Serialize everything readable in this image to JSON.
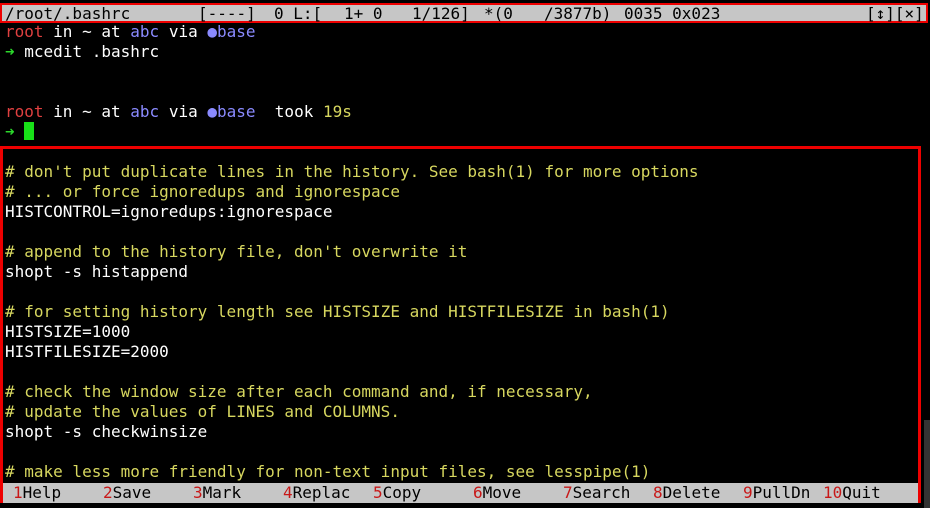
{
  "colors": {
    "comment": "#d7d75f",
    "prompt_user": "#e04040",
    "prompt_accent": "#8a8aff",
    "prompt_arrow": "#2bd92b",
    "highlight_frame": "#ee0000",
    "statusbar_bg": "#c6c6c6"
  },
  "titlebar": {
    "path": "/root/.bashrc",
    "flags": "[----]",
    "col": "0 L:[",
    "line_pos": "1+ 0",
    "line_total": "1/126]",
    "char_pos": "*(0",
    "char_total": "/3877b)",
    "char_code": "0035 0x023",
    "buttons": "[↕][×]"
  },
  "terminal": {
    "line1": {
      "user": "root",
      "in": "in",
      "dir": "~",
      "at": "at",
      "host": "abc",
      "via": "via",
      "env_icon": "●",
      "env": "base"
    },
    "line2": {
      "arrow": "➜",
      "command": "mcedit .bashrc"
    },
    "line3": {
      "user": "root",
      "in": "in",
      "dir": "~",
      "at": "at",
      "host": "abc",
      "via": "via",
      "env_icon": "●",
      "env": "base",
      "took": "took",
      "duration": "19s"
    },
    "line4": {
      "arrow": "➜"
    }
  },
  "editor": {
    "lines": [
      {
        "type": "comment",
        "text": "# don't put duplicate lines in the history. See bash(1) for more options"
      },
      {
        "type": "comment",
        "text": "# ... or force ignoredups and ignorespace"
      },
      {
        "type": "code",
        "text": "HISTCONTROL=ignoredups:ignorespace"
      },
      {
        "type": "blank",
        "text": ""
      },
      {
        "type": "comment",
        "text": "# append to the history file, don't overwrite it"
      },
      {
        "type": "code",
        "text": "shopt -s histappend"
      },
      {
        "type": "blank",
        "text": ""
      },
      {
        "type": "comment",
        "text": "# for setting history length see HISTSIZE and HISTFILESIZE in bash(1)"
      },
      {
        "type": "code",
        "text": "HISTSIZE=1000"
      },
      {
        "type": "code",
        "text": "HISTFILESIZE=2000"
      },
      {
        "type": "blank",
        "text": ""
      },
      {
        "type": "comment",
        "text": "# check the window size after each command and, if necessary,"
      },
      {
        "type": "comment",
        "text": "# update the values of LINES and COLUMNS."
      },
      {
        "type": "code",
        "text": "shopt -s checkwinsize"
      },
      {
        "type": "blank",
        "text": ""
      },
      {
        "type": "comment",
        "text": "# make less more friendly for non-text input files, see lesspipe(1)"
      }
    ]
  },
  "function_keys": [
    {
      "num": "1",
      "label": "Help"
    },
    {
      "num": "2",
      "label": "Save"
    },
    {
      "num": "3",
      "label": "Mark"
    },
    {
      "num": "4",
      "label": "Replac"
    },
    {
      "num": "5",
      "label": "Copy"
    },
    {
      "num": "6",
      "label": "Move"
    },
    {
      "num": "7",
      "label": "Search"
    },
    {
      "num": "8",
      "label": "Delete"
    },
    {
      "num": "9",
      "label": "PullDn"
    },
    {
      "num": "10",
      "label": "Quit"
    }
  ]
}
